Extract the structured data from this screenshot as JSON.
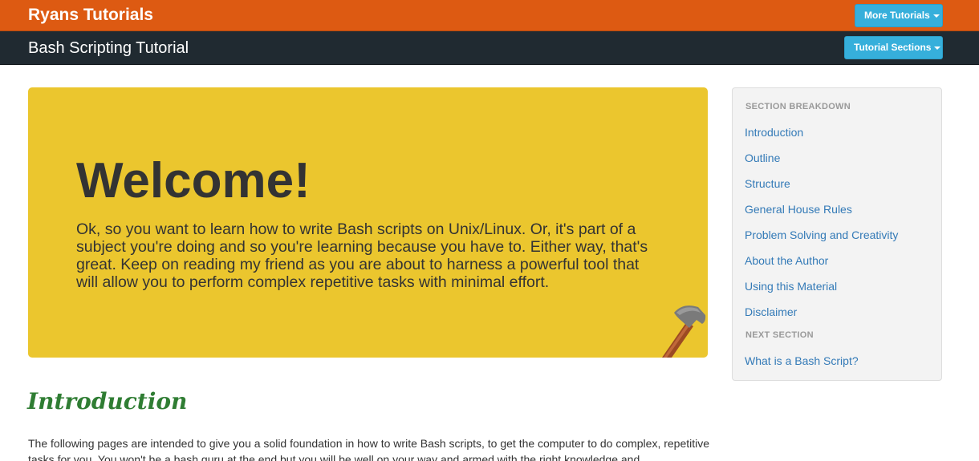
{
  "topbar": {
    "brand": "Ryans Tutorials",
    "more_button": "More Tutorials"
  },
  "subbar": {
    "title": "Bash Scripting Tutorial",
    "sections_button": "Tutorial Sections"
  },
  "hero": {
    "title": "Welcome!",
    "text": "Ok, so you want to learn how to write Bash scripts on Unix/Linux. Or, it's part of a subject you're doing and so you're learning because you have to. Either way, that's great. Keep on reading my friend as you are about to harness a powerful tool that will allow you to perform complex repetitive tasks with minimal effort.",
    "illustration": "hammer-and-nail"
  },
  "content": {
    "heading": "Introduction",
    "paragraph": "The following pages are intended to give you a solid foundation in how to write Bash scripts, to get the computer to do complex, repetitive tasks for you. You won't be a bash guru at the end but you will be well on your way and armed with the right knowledge and"
  },
  "sidenav": {
    "breakdown_header": "SECTION BREAKDOWN",
    "items": [
      {
        "label": "Introduction"
      },
      {
        "label": "Outline"
      },
      {
        "label": "Structure"
      },
      {
        "label": "General House Rules"
      },
      {
        "label": "Problem Solving and Creativity"
      },
      {
        "label": "About the Author"
      },
      {
        "label": "Using this Material"
      },
      {
        "label": "Disclaimer"
      }
    ],
    "next_header": "NEXT SECTION",
    "next_link": "What is a Bash Script?"
  },
  "colors": {
    "topbar": "#dd5a12",
    "subbar": "#202a31",
    "button": "#36afdb",
    "hero": "#ebc62e",
    "heading": "#2f7d33",
    "link": "#337ab7"
  }
}
